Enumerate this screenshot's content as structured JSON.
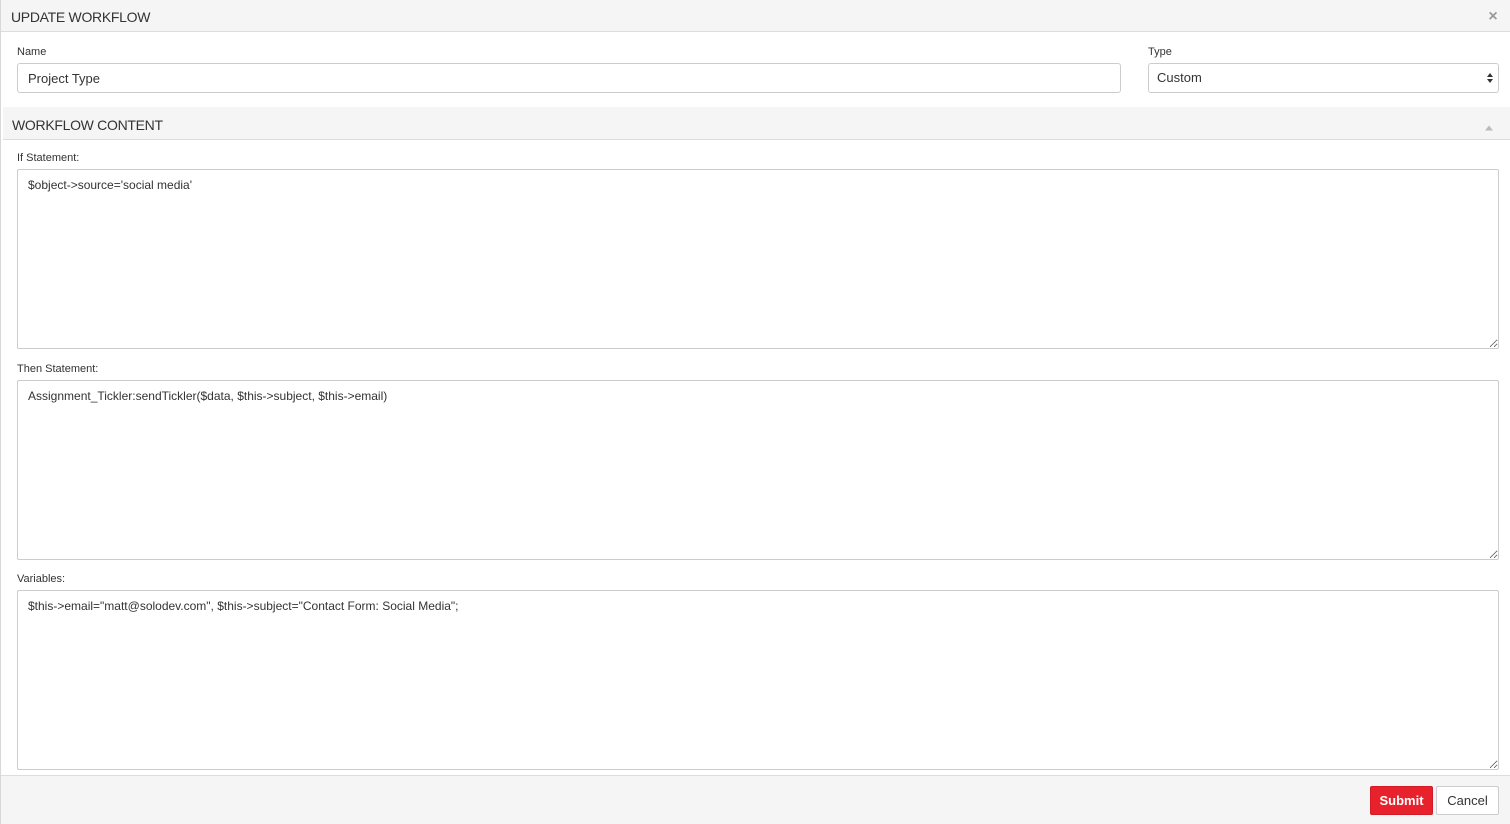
{
  "header": {
    "title": "UPDATE WORKFLOW",
    "close_icon": "close-icon"
  },
  "form": {
    "name": {
      "label": "Name",
      "value": "Project Type"
    },
    "type": {
      "label": "Type",
      "selected": "Custom"
    }
  },
  "content_section": {
    "title": "WORKFLOW CONTENT",
    "collapse_icon": "chevron-up-icon",
    "if_statement": {
      "label": "If Statement:",
      "value": "$object->source='social media'"
    },
    "then_statement": {
      "label": "Then Statement:",
      "value": "Assignment_Tickler:sendTickler($data, $this->subject, $this->email)"
    },
    "variables": {
      "label": "Variables:",
      "value": "$this->email=\"matt@solodev.com\", $this->subject=\"Contact Form: Social Media\";"
    }
  },
  "footer": {
    "submit_label": "Submit",
    "cancel_label": "Cancel"
  },
  "colors": {
    "submit_bg": "#e8222d",
    "header_bg": "#f5f5f5"
  }
}
